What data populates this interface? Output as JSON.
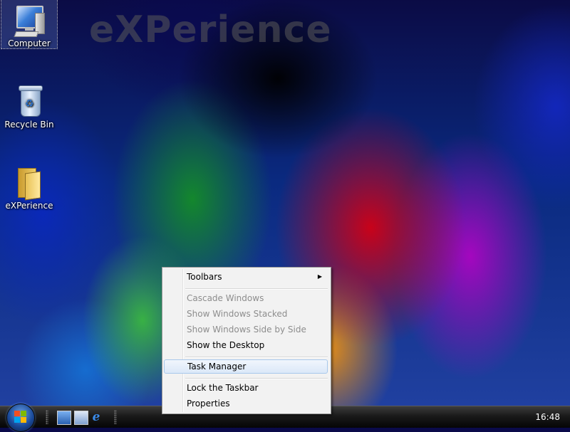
{
  "desktop": {
    "watermark": "eXPerience",
    "icons": [
      {
        "label": "Computer",
        "icon": "computer-icon",
        "selected": true
      },
      {
        "label": "Recycle Bin",
        "icon": "recycle-bin-icon"
      },
      {
        "label": "eXPerience",
        "icon": "folder-icon"
      }
    ]
  },
  "context_menu": {
    "items": [
      {
        "label": "Toolbars",
        "access_key": "T",
        "has_submenu": true,
        "enabled": true
      },
      {
        "label": "Cascade Windows",
        "enabled": false
      },
      {
        "label": "Show Windows Stacked",
        "enabled": false
      },
      {
        "label": "Show Windows Side by Side",
        "enabled": false
      },
      {
        "label": "Show the Desktop",
        "enabled": true
      },
      {
        "label": "Task Manager",
        "enabled": true,
        "highlighted": true
      },
      {
        "label": "Lock the Taskbar",
        "enabled": true
      },
      {
        "label": "Properties",
        "enabled": true
      }
    ],
    "submenu_arrow": "▶"
  },
  "taskbar": {
    "clock": "16:48",
    "quick_launch": [
      {
        "icon": "show-desktop-icon"
      },
      {
        "icon": "switch-windows-icon"
      },
      {
        "icon": "internet-explorer-icon"
      }
    ]
  },
  "colors": {
    "menu_bg": "#f2f2f2",
    "menu_hover": "#dbe8f8",
    "disabled_text": "#8d8d8d",
    "taskbar": "#1a1a1a"
  }
}
